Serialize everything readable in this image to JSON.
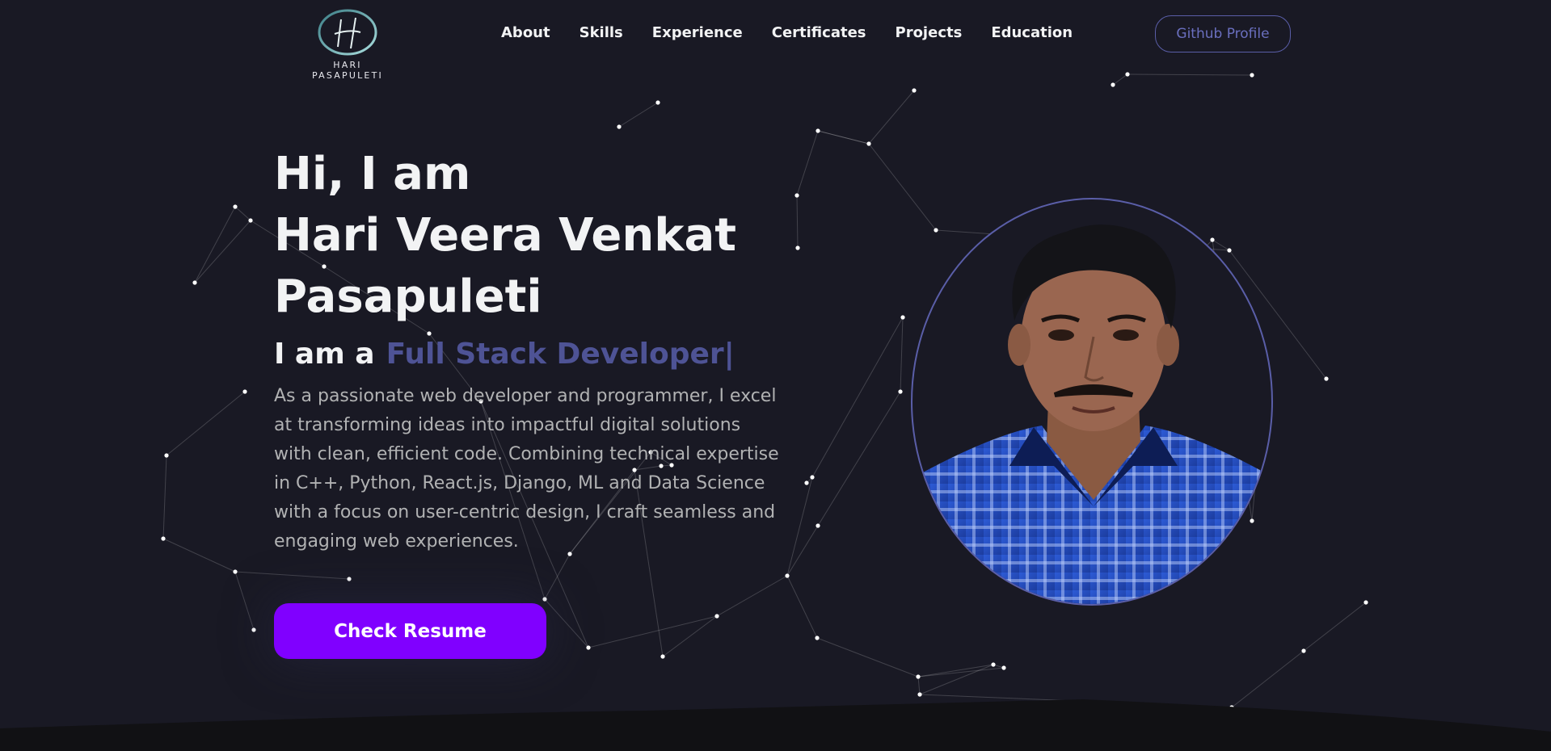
{
  "logo": {
    "name": "HARI PASAPULETI",
    "monogram": "H",
    "icon": "h-monogram-logo"
  },
  "nav": {
    "items": [
      {
        "label": "About"
      },
      {
        "label": "Skills"
      },
      {
        "label": "Experience"
      },
      {
        "label": "Certificates"
      },
      {
        "label": "Projects"
      },
      {
        "label": "Education"
      }
    ],
    "github_label": "Github Profile"
  },
  "hero": {
    "title_line1": "Hi, I am",
    "title_line2": "Hari Veera Venkat",
    "title_line3": "Pasapuleti",
    "subtitle_lead": "I am a",
    "subtitle_role": "Full Stack Developer|",
    "description": "As a passionate web developer and programmer, I excel at transforming ideas into impactful digital solutions with clean, efficient code. Combining technical expertise in C++, Python, React.js, Django, ML and Data Science with a focus on user-centric design, I craft seamless and engaging web experiences.",
    "resume_label": "Check Resume"
  },
  "colors": {
    "background": "#191924",
    "primary": "#8000ff",
    "accent_text": "#4e5395",
    "secondary_text": "#b1b2b3",
    "outline": "#5a5ea8"
  }
}
